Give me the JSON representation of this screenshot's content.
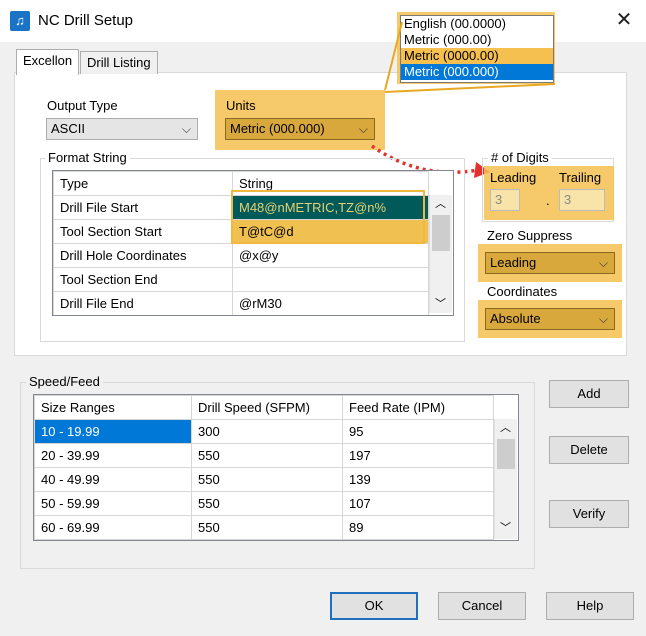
{
  "window": {
    "title": "NC Drill Setup",
    "close": "✕"
  },
  "tabs": [
    {
      "label": "Excellon"
    },
    {
      "label": "Drill Listing"
    }
  ],
  "output_type": {
    "label": "Output Type",
    "value": "ASCII"
  },
  "units": {
    "label": "Units",
    "value": "Metric (000.000)",
    "options": [
      "English (00.0000)",
      "Metric (000.00)",
      "Metric (0000.00)",
      "Metric (000.000)"
    ]
  },
  "format_string": {
    "label": "Format String",
    "headers": [
      "Type",
      "String"
    ],
    "rows": [
      [
        "Drill File Start",
        "M48@nMETRIC,TZ@n%"
      ],
      [
        "Tool Section Start",
        "T@tC@d"
      ],
      [
        "Drill Hole Coordinates",
        "@x@y"
      ],
      [
        "Tool Section End",
        ""
      ],
      [
        "Drill File End",
        "@rM30"
      ]
    ]
  },
  "digits": {
    "label": "# of Digits",
    "leading_label": "Leading",
    "trailing_label": "Trailing",
    "leading": "3",
    "trailing": "3",
    "separator": "."
  },
  "zero_suppress": {
    "label": "Zero Suppress",
    "value": "Leading"
  },
  "coordinates": {
    "label": "Coordinates",
    "value": "Absolute"
  },
  "speed_feed": {
    "label": "Speed/Feed",
    "headers": [
      "Size Ranges",
      "Drill Speed (SFPM)",
      "Feed Rate (IPM)"
    ],
    "rows": [
      [
        "10 - 19.99",
        "300",
        "95"
      ],
      [
        "20 - 39.99",
        "550",
        "197"
      ],
      [
        "40 - 49.99",
        "550",
        "139"
      ],
      [
        "50 - 59.99",
        "550",
        "107"
      ],
      [
        "60 - 69.99",
        "550",
        "89"
      ]
    ]
  },
  "buttons": {
    "add": "Add",
    "delete": "Delete",
    "verify": "Verify",
    "ok": "OK",
    "cancel": "Cancel",
    "help": "Help"
  },
  "colors": {
    "highlight": "#f5c050",
    "selection": "#0078d7",
    "dark_teal": "#005a5a"
  }
}
